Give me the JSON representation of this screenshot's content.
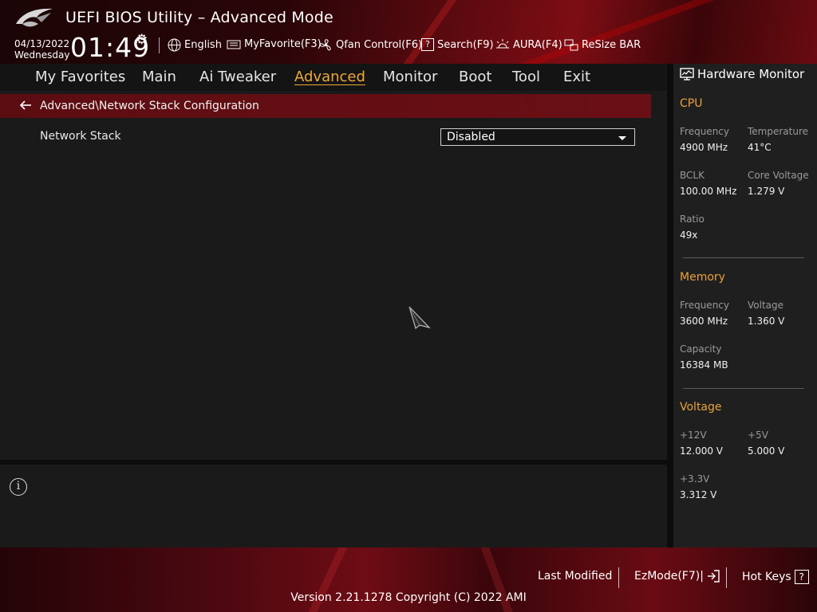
{
  "header": {
    "title": "UEFI BIOS Utility – Advanced Mode",
    "date": "04/13/2022",
    "weekday": "Wednesday",
    "time": "01:49",
    "toolbar": {
      "language": "English",
      "myfavorite": "MyFavorite(F3)",
      "qfan": "Qfan Control(F6)",
      "search": "Search(F9)",
      "aura": "AURA(F4)",
      "resizebar": "ReSize BAR"
    }
  },
  "menu": {
    "items": [
      "My Favorites",
      "Main",
      "Ai Tweaker",
      "Advanced",
      "Monitor",
      "Boot",
      "Tool",
      "Exit"
    ],
    "active": "Advanced"
  },
  "page": {
    "breadcrumb": "Advanced\\Network Stack Configuration",
    "settings": [
      {
        "label": "Network Stack",
        "value": "Disabled"
      }
    ]
  },
  "hardware_monitor": {
    "title": "Hardware Monitor",
    "cpu": {
      "section": "CPU",
      "frequency_label": "Frequency",
      "frequency": "4900 MHz",
      "temperature_label": "Temperature",
      "temperature": "41°C",
      "bclk_label": "BCLK",
      "bclk": "100.00 MHz",
      "core_voltage_label": "Core Voltage",
      "core_voltage": "1.279 V",
      "ratio_label": "Ratio",
      "ratio": "49x"
    },
    "memory": {
      "section": "Memory",
      "frequency_label": "Frequency",
      "frequency": "3600 MHz",
      "voltage_label": "Voltage",
      "voltage": "1.360 V",
      "capacity_label": "Capacity",
      "capacity": "16384 MB"
    },
    "voltage": {
      "section": "Voltage",
      "v12_label": "+12V",
      "v12": "12.000 V",
      "v5_label": "+5V",
      "v5": "5.000 V",
      "v33_label": "+3.3V",
      "v33": "3.312 V"
    }
  },
  "footer": {
    "last_modified": "Last Modified",
    "ezmode": "EzMode(F7)|",
    "hotkeys": "Hot Keys",
    "hotkeys_key": "?",
    "version": "Version 2.21.1278 Copyright (C) 2022 AMI"
  },
  "colors": {
    "accent": "#e9a23b",
    "breadcrumb_bg": "#5c0d12",
    "panel_bg": "#1a1a1a"
  }
}
